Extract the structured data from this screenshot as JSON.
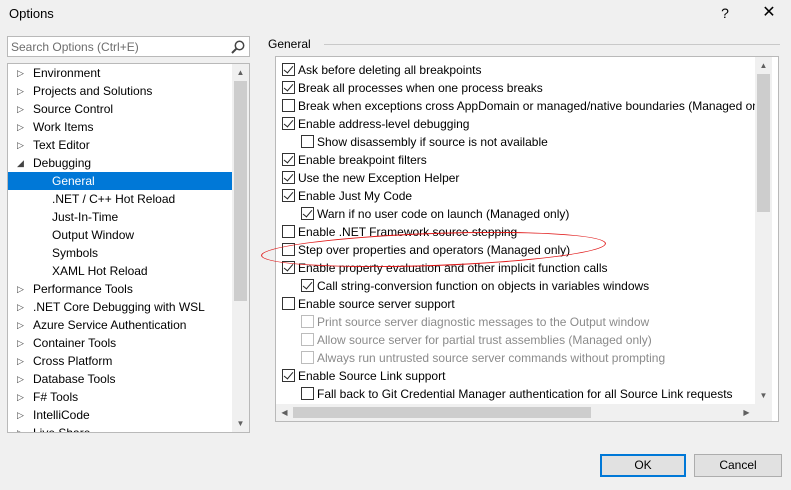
{
  "window": {
    "title": "Options",
    "help_glyph": "?",
    "close_glyph": "✕"
  },
  "search": {
    "placeholder": "Search Options (Ctrl+E)",
    "icon": "search-icon"
  },
  "tree": {
    "items": [
      {
        "label": "Environment",
        "level": 0,
        "expander": "collapsed"
      },
      {
        "label": "Projects and Solutions",
        "level": 0,
        "expander": "collapsed"
      },
      {
        "label": "Source Control",
        "level": 0,
        "expander": "collapsed"
      },
      {
        "label": "Work Items",
        "level": 0,
        "expander": "collapsed"
      },
      {
        "label": "Text Editor",
        "level": 0,
        "expander": "collapsed"
      },
      {
        "label": "Debugging",
        "level": 0,
        "expander": "expanded"
      },
      {
        "label": "General",
        "level": 1,
        "selected": true
      },
      {
        "label": ".NET / C++ Hot Reload",
        "level": 1
      },
      {
        "label": "Just-In-Time",
        "level": 1
      },
      {
        "label": "Output Window",
        "level": 1
      },
      {
        "label": "Symbols",
        "level": 1
      },
      {
        "label": "XAML Hot Reload",
        "level": 1
      },
      {
        "label": "Performance Tools",
        "level": 0,
        "expander": "collapsed"
      },
      {
        "label": ".NET Core Debugging with WSL",
        "level": 0,
        "expander": "collapsed"
      },
      {
        "label": "Azure Service Authentication",
        "level": 0,
        "expander": "collapsed"
      },
      {
        "label": "Container Tools",
        "level": 0,
        "expander": "collapsed"
      },
      {
        "label": "Cross Platform",
        "level": 0,
        "expander": "collapsed"
      },
      {
        "label": "Database Tools",
        "level": 0,
        "expander": "collapsed"
      },
      {
        "label": "F# Tools",
        "level": 0,
        "expander": "collapsed"
      },
      {
        "label": "IntelliCode",
        "level": 0,
        "expander": "collapsed"
      },
      {
        "label": "Live Share",
        "level": 0,
        "expander": "collapsed"
      }
    ]
  },
  "section": {
    "title": "General"
  },
  "options": [
    {
      "label": "Ask before deleting all breakpoints",
      "level": 0,
      "checked": true,
      "enabled": true
    },
    {
      "label": "Break all processes when one process breaks",
      "level": 0,
      "checked": true,
      "enabled": true
    },
    {
      "label": "Break when exceptions cross AppDomain or managed/native boundaries (Managed only)",
      "level": 0,
      "checked": false,
      "enabled": true
    },
    {
      "label": "Enable address-level debugging",
      "level": 0,
      "checked": true,
      "enabled": true
    },
    {
      "label": "Show disassembly if source is not available",
      "level": 1,
      "checked": false,
      "enabled": true
    },
    {
      "label": "Enable breakpoint filters",
      "level": 0,
      "checked": true,
      "enabled": true
    },
    {
      "label": "Use the new Exception Helper",
      "level": 0,
      "checked": true,
      "enabled": true
    },
    {
      "label": "Enable Just My Code",
      "level": 0,
      "checked": true,
      "enabled": true
    },
    {
      "label": "Warn if no user code on launch (Managed only)",
      "level": 1,
      "checked": true,
      "enabled": true
    },
    {
      "label": "Enable .NET Framework source stepping",
      "level": 0,
      "checked": false,
      "enabled": true
    },
    {
      "label": "Step over properties and operators (Managed only)",
      "level": 0,
      "checked": false,
      "enabled": true,
      "annotated": true
    },
    {
      "label": "Enable property evaluation and other implicit function calls",
      "level": 0,
      "checked": true,
      "enabled": true
    },
    {
      "label": "Call string-conversion function on objects in variables windows",
      "level": 1,
      "checked": true,
      "enabled": true
    },
    {
      "label": "Enable source server support",
      "level": 0,
      "checked": false,
      "enabled": true
    },
    {
      "label": "Print source server diagnostic messages to the Output window",
      "level": 1,
      "checked": false,
      "enabled": false
    },
    {
      "label": "Allow source server for partial trust assemblies (Managed only)",
      "level": 1,
      "checked": false,
      "enabled": false
    },
    {
      "label": "Always run untrusted source server commands without prompting",
      "level": 1,
      "checked": false,
      "enabled": false
    },
    {
      "label": "Enable Source Link support",
      "level": 0,
      "checked": true,
      "enabled": true
    },
    {
      "label": "Fall back to Git Credential Manager authentication for all Source Link requests",
      "level": 1,
      "checked": false,
      "enabled": true
    }
  ],
  "annotation": {
    "color": "#e01818",
    "shape": "hand-drawn-ellipse"
  },
  "buttons": {
    "ok": "OK",
    "cancel": "Cancel"
  },
  "colors": {
    "selection": "#0078d7",
    "window_bg": "#f0f0f0"
  }
}
